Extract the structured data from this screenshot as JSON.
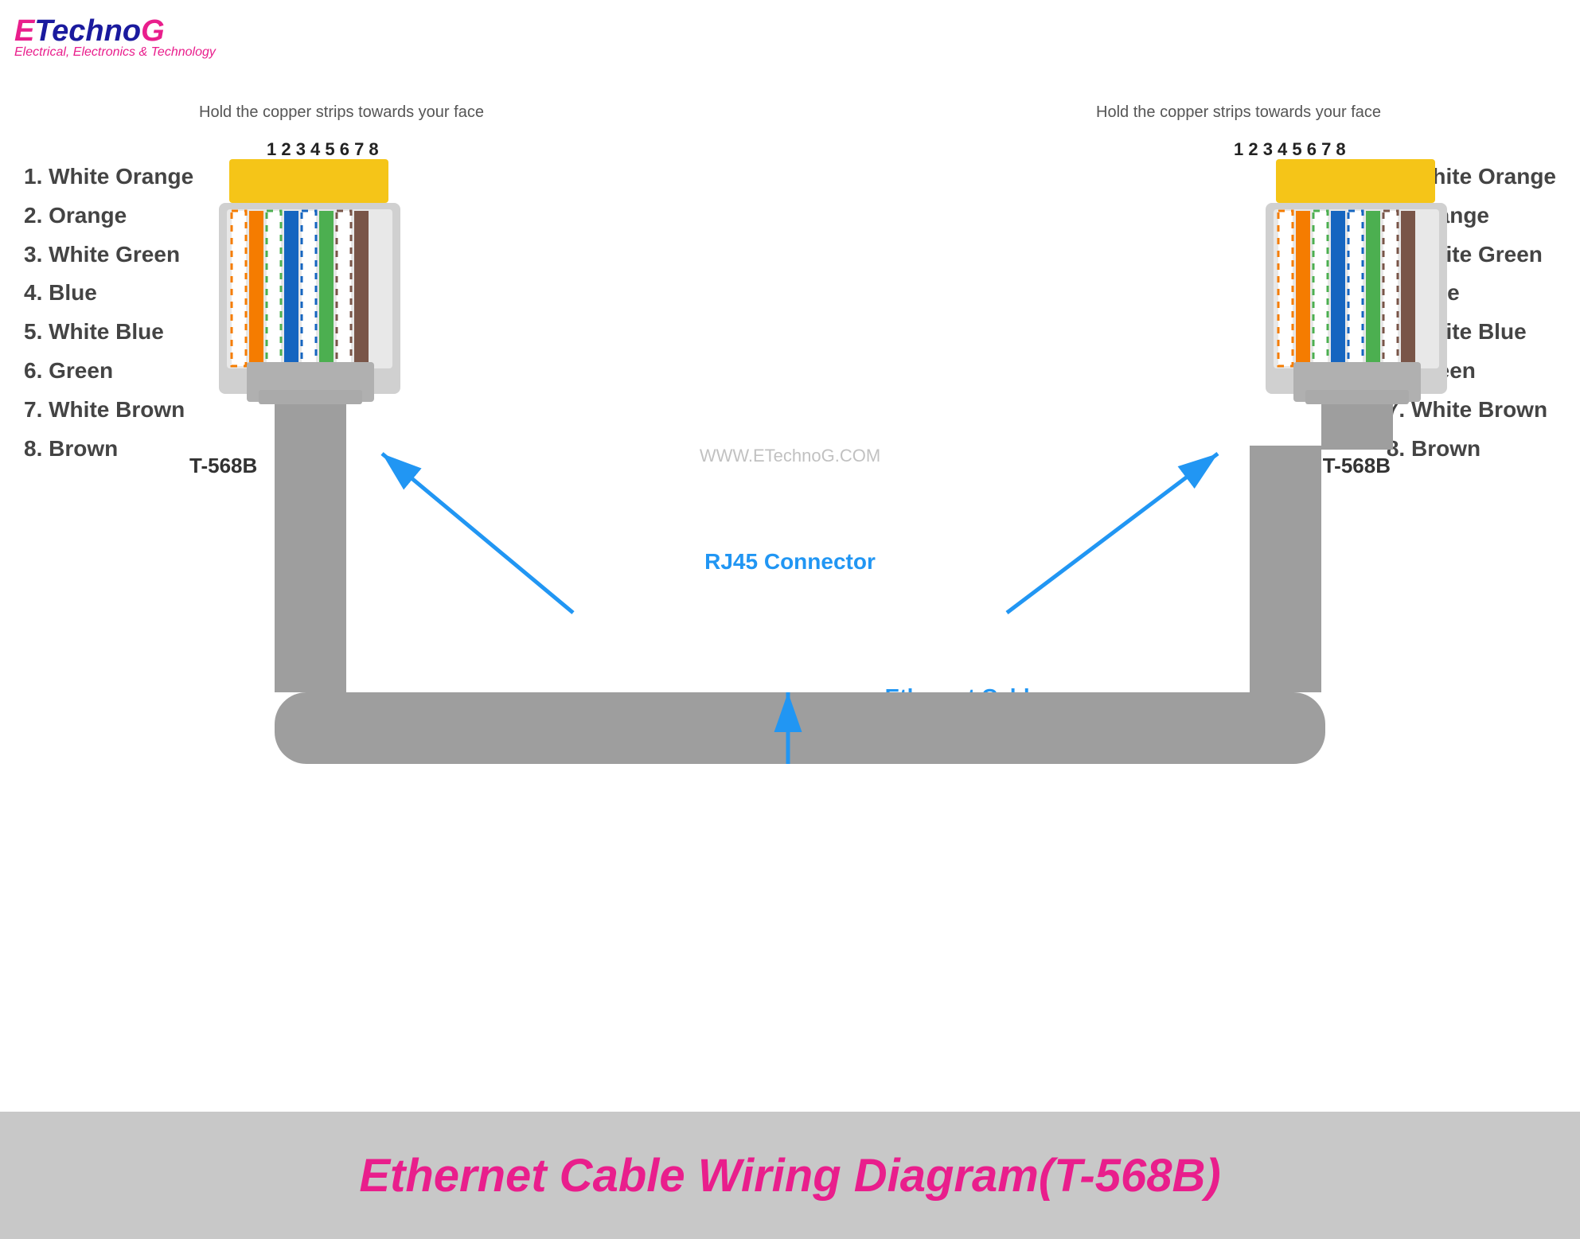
{
  "logo": {
    "e": "E",
    "techno": "Techno",
    "g": "G",
    "subtitle": "Electrical, Electronics & Technology"
  },
  "instruction": "Hold the copper strips towards your face",
  "pin_numbers": "1 2 3 4 5 6 7 8",
  "pins_left": [
    "1. White Orange",
    "2. Orange",
    "3. White Green",
    "4. Blue",
    "5. White Blue",
    "6. Green",
    "7. White Brown",
    "8. Brown"
  ],
  "pins_right": [
    "1. White Orange",
    "2. Orange",
    "3. White Green",
    "4. Blue",
    "5. White Blue",
    "6. Green",
    "7. White Brown",
    "8. Brown"
  ],
  "connector_label": "T-568B",
  "rj45_label": "RJ45 Connector",
  "ethernet_label": "Ethernet Cable",
  "watermark": "WWW.ETechnoG.COM",
  "banner_text": "Ethernet Cable Wiring Diagram(T-568B)"
}
